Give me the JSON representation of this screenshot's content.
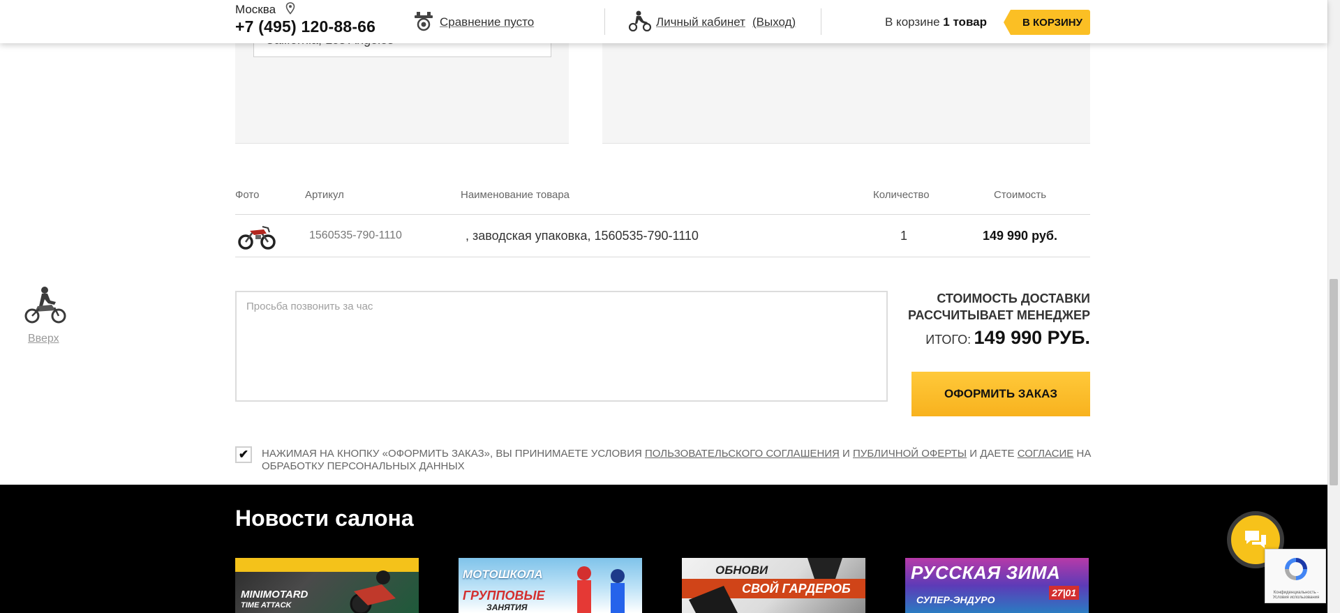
{
  "header": {
    "city": "Москва",
    "phone": "+7 (495) 120-88-66",
    "compare_label": "Сравнение пусто",
    "account_label": "Личный кабинет",
    "logout_label": "(Выход)",
    "cart_prefix": "В корзине",
    "cart_count": "1 товар",
    "cart_button": "В КОРЗИНУ"
  },
  "address": {
    "value": "California, Los Angeles"
  },
  "table": {
    "headers": {
      "photo": "Фото",
      "sku": "Артикул",
      "name": "Наименование товара",
      "qty": "Количество",
      "price": "Стоимость"
    },
    "rows": [
      {
        "sku": "1560535-790-1110",
        "name": ", заводская упаковка, 1560535-790-1110",
        "qty": "1",
        "price": "149 990 руб."
      }
    ]
  },
  "order": {
    "comment_placeholder": "Просьба позвонить за час",
    "delivery_note_line1": "СТОИМОСТЬ ДОСТАВКИ",
    "delivery_note_line2": "РАССЧИТЫВАЕТ МЕНЕДЖЕР",
    "total_label": "ИТОГО:",
    "total_value": "149 990 РУБ.",
    "checkout_button": "ОФОРМИТЬ ЗАКАЗ"
  },
  "agreement": {
    "checked": true,
    "check_mark": "✔",
    "text_part1": "НАЖИМАЯ НА КНОПКУ «ОФОРМИТЬ ЗАКАЗ», ВЫ ПРИНИМАЕТЕ УСЛОВИЯ ",
    "link_user_agreement": "ПОЛЬЗОВАТЕЛЬСКОГО СОГЛАШЕНИЯ",
    "text_and": " И ",
    "link_public_offer": "ПУБЛИЧНОЙ ОФЕРТЫ",
    "text_give": " И ДАЕТЕ ",
    "link_consent": "СОГЛАСИЕ",
    "text_part2": " НА ОБРАБОТКУ ПЕРСОНАЛЬНЫХ ДАННЫХ"
  },
  "to_top": {
    "label": "Вверх"
  },
  "news": {
    "title": "Новости салона",
    "cards": [
      {
        "line1": "MINIMOTARD",
        "line2": "TIME ATTACK"
      },
      {
        "line1": "МОТОШКОЛА",
        "line2": "ГРУППОВЫЕ",
        "line3": "ЗАНЯТИЯ"
      },
      {
        "line1": "ОБНОВИ",
        "line2": "СВОЙ ГАРДЕРОБ"
      },
      {
        "line1": "РУССКАЯ ЗИМА",
        "line2": "СУПЕР-ЭНДУРО",
        "line3": "27|01"
      }
    ]
  },
  "recaptcha": {
    "text": "Конфиденциальность - Условия использования"
  },
  "colors": {
    "accent": "#fbbf24",
    "footer_bg": "#000000"
  }
}
